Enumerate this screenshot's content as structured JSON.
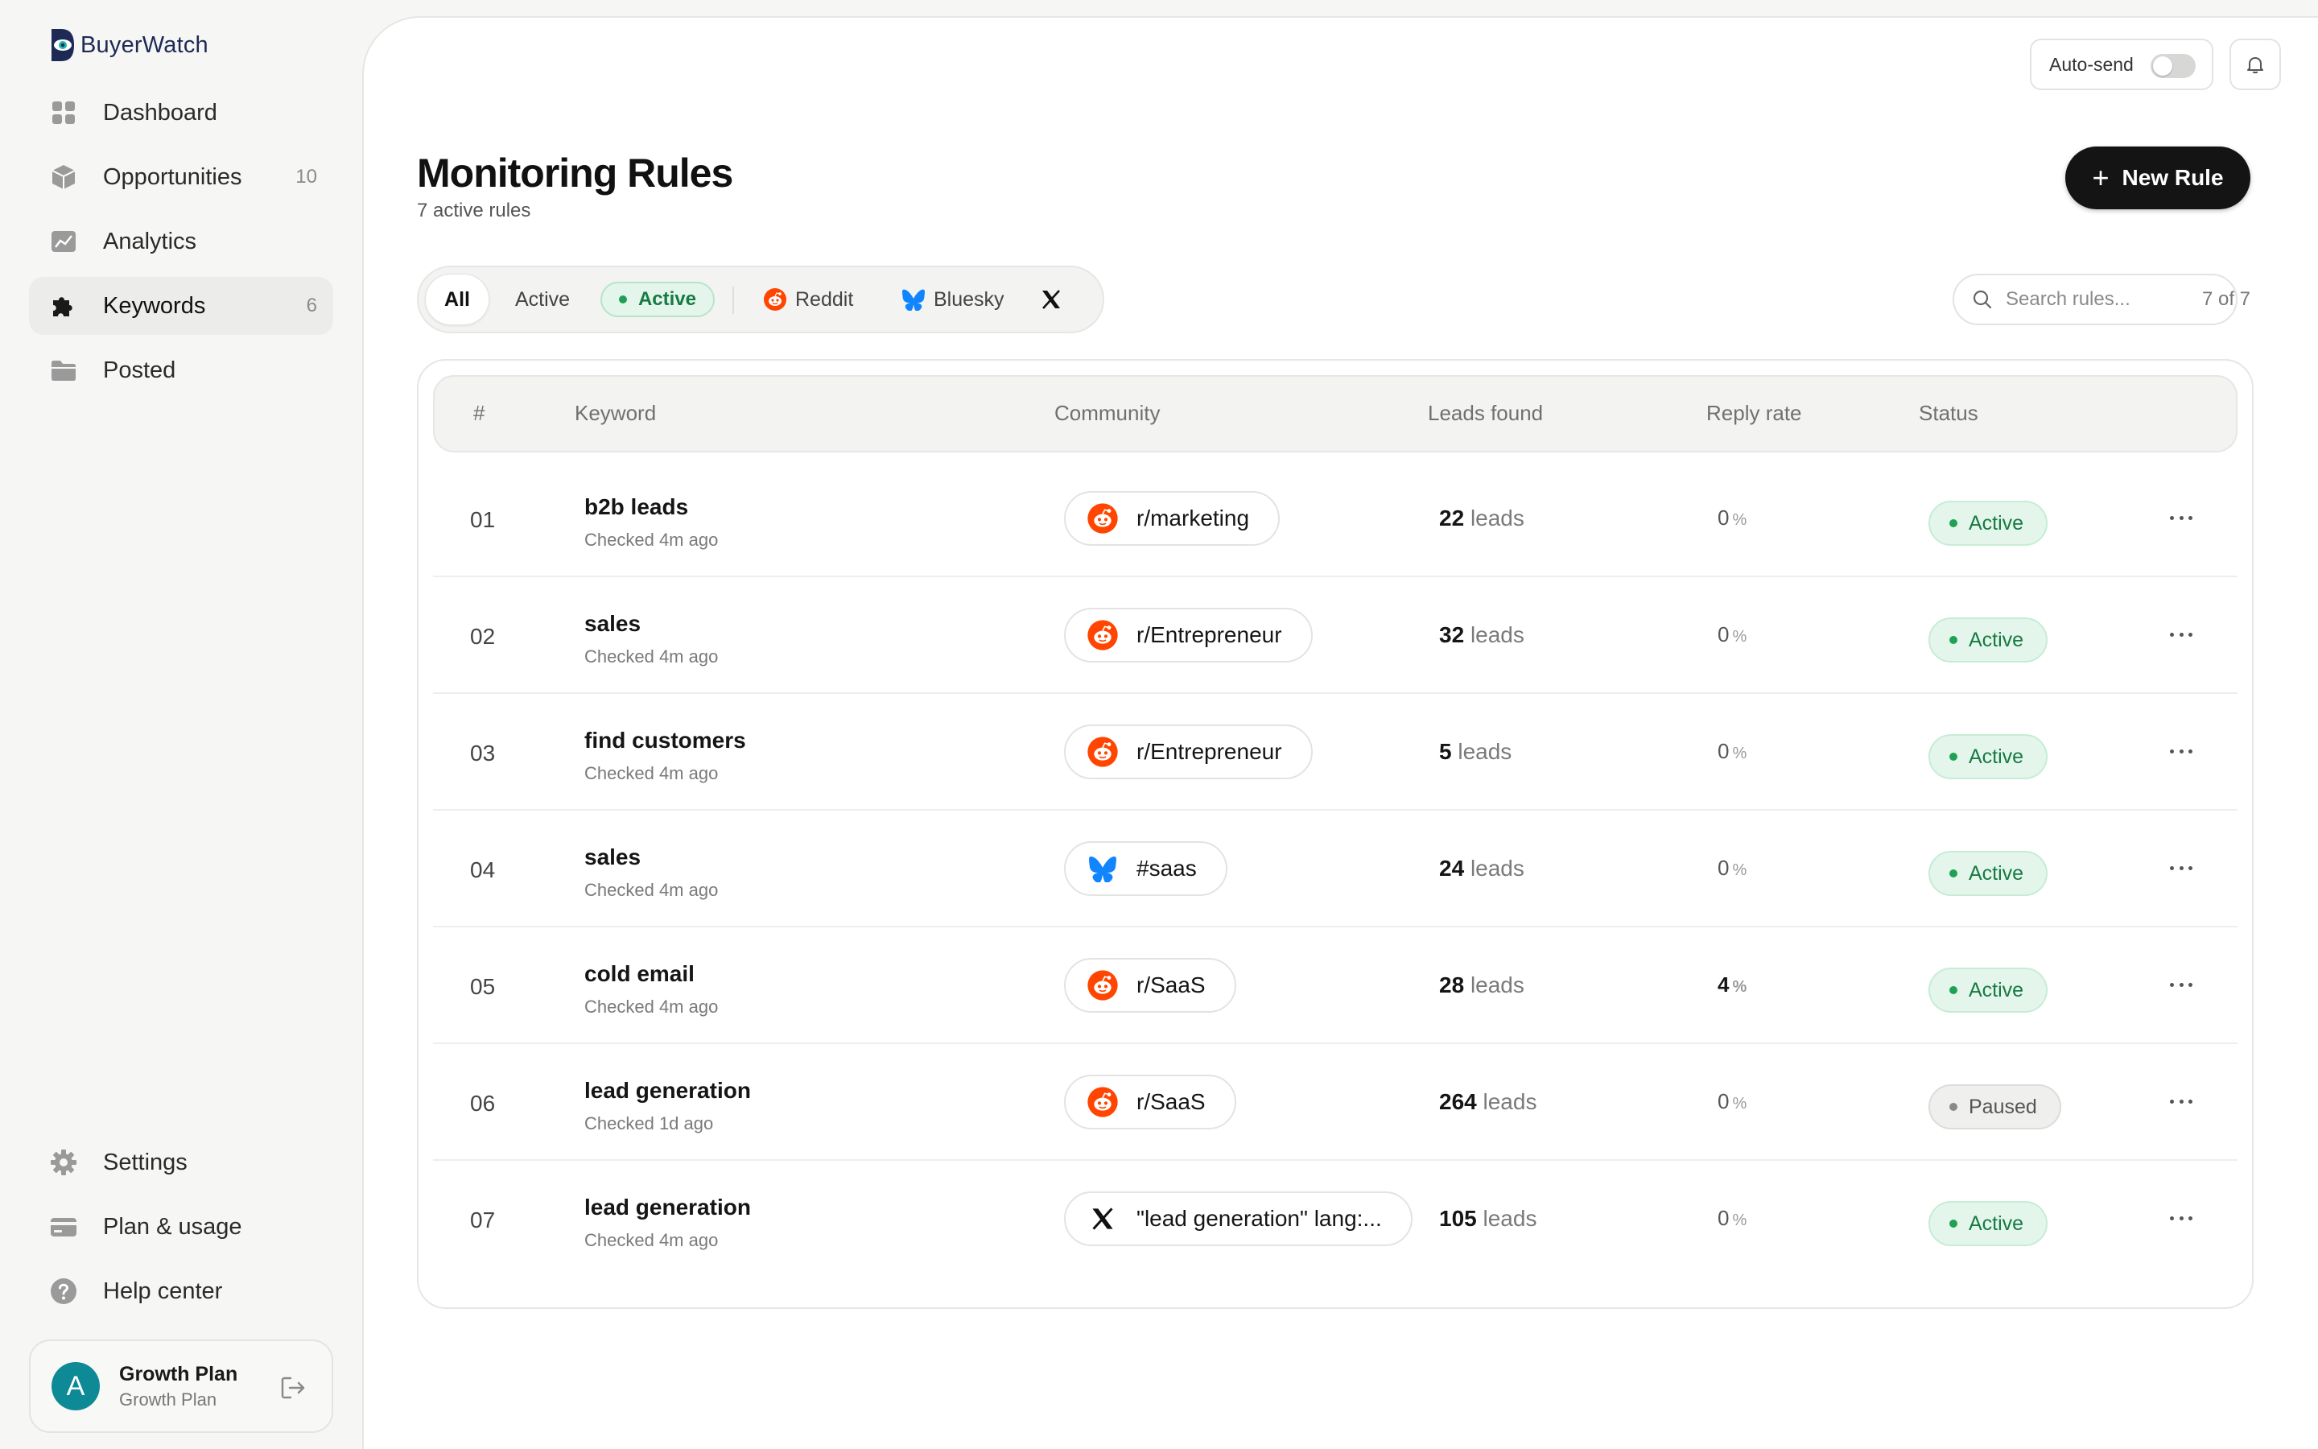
{
  "brand": {
    "name": "BuyerWatch"
  },
  "nav": {
    "items": [
      {
        "label": "Dashboard",
        "icon": "grid-icon"
      },
      {
        "label": "Opportunities",
        "icon": "cube-icon",
        "count": "10"
      },
      {
        "label": "Analytics",
        "icon": "chart-icon"
      },
      {
        "label": "Keywords",
        "icon": "puzzle-icon",
        "count": "6",
        "active": true
      },
      {
        "label": "Posted",
        "icon": "folder-icon"
      }
    ],
    "bottom": [
      {
        "label": "Settings",
        "icon": "gear-icon"
      },
      {
        "label": "Plan & usage",
        "icon": "card-icon"
      },
      {
        "label": "Help center",
        "icon": "help-icon"
      }
    ]
  },
  "user": {
    "initial": "A",
    "name": "Growth Plan",
    "plan": "Growth Plan"
  },
  "header": {
    "autosend_label": "Auto-send",
    "autosend_on": false
  },
  "page": {
    "title": "Monitoring Rules",
    "subtitle": "7 active rules",
    "new_rule_label": "New Rule"
  },
  "filters": {
    "all": "All",
    "active_text": "Active",
    "active_pill": "Active",
    "reddit": "Reddit",
    "bluesky": "Bluesky",
    "x": "X"
  },
  "search": {
    "placeholder": "Search rules...",
    "count": "7 of 7"
  },
  "table": {
    "headers": {
      "num": "#",
      "keyword": "Keyword",
      "community": "Community",
      "leads": "Leads found",
      "reply": "Reply rate",
      "status": "Status"
    },
    "rows": [
      {
        "num": "01",
        "keyword": "b2b leads",
        "checked": "Checked 4m ago",
        "platform": "reddit",
        "community": "r/marketing",
        "leads": "22",
        "leads_unit": "leads",
        "reply": "0",
        "reply_unit": "%",
        "status": "Active"
      },
      {
        "num": "02",
        "keyword": "sales",
        "checked": "Checked 4m ago",
        "platform": "reddit",
        "community": "r/Entrepreneur",
        "leads": "32",
        "leads_unit": "leads",
        "reply": "0",
        "reply_unit": "%",
        "status": "Active"
      },
      {
        "num": "03",
        "keyword": "find customers",
        "checked": "Checked 4m ago",
        "platform": "reddit",
        "community": "r/Entrepreneur",
        "leads": "5",
        "leads_unit": "leads",
        "reply": "0",
        "reply_unit": "%",
        "status": "Active"
      },
      {
        "num": "04",
        "keyword": "sales",
        "checked": "Checked 4m ago",
        "platform": "bluesky",
        "community": "#saas",
        "leads": "24",
        "leads_unit": "leads",
        "reply": "0",
        "reply_unit": "%",
        "status": "Active"
      },
      {
        "num": "05",
        "keyword": "cold email",
        "checked": "Checked 4m ago",
        "platform": "reddit",
        "community": "r/SaaS",
        "leads": "28",
        "leads_unit": "leads",
        "reply": "4",
        "reply_unit": "%",
        "status": "Active"
      },
      {
        "num": "06",
        "keyword": "lead generation",
        "checked": "Checked 1d ago",
        "platform": "reddit",
        "community": "r/SaaS",
        "leads": "264",
        "leads_unit": "leads",
        "reply": "0",
        "reply_unit": "%",
        "status": "Paused"
      },
      {
        "num": "07",
        "keyword": "lead generation",
        "checked": "Checked 4m ago",
        "platform": "x",
        "community": "\"lead generation\" lang:...",
        "leads": "105",
        "leads_unit": "leads",
        "reply": "0",
        "reply_unit": "%",
        "status": "Active"
      }
    ]
  },
  "colors": {
    "reddit": "#ff4500",
    "bluesky": "#1185fe",
    "active_green": "#177a43",
    "brand_navy": "#1e2a55",
    "avatar_teal": "#0e8a96"
  }
}
